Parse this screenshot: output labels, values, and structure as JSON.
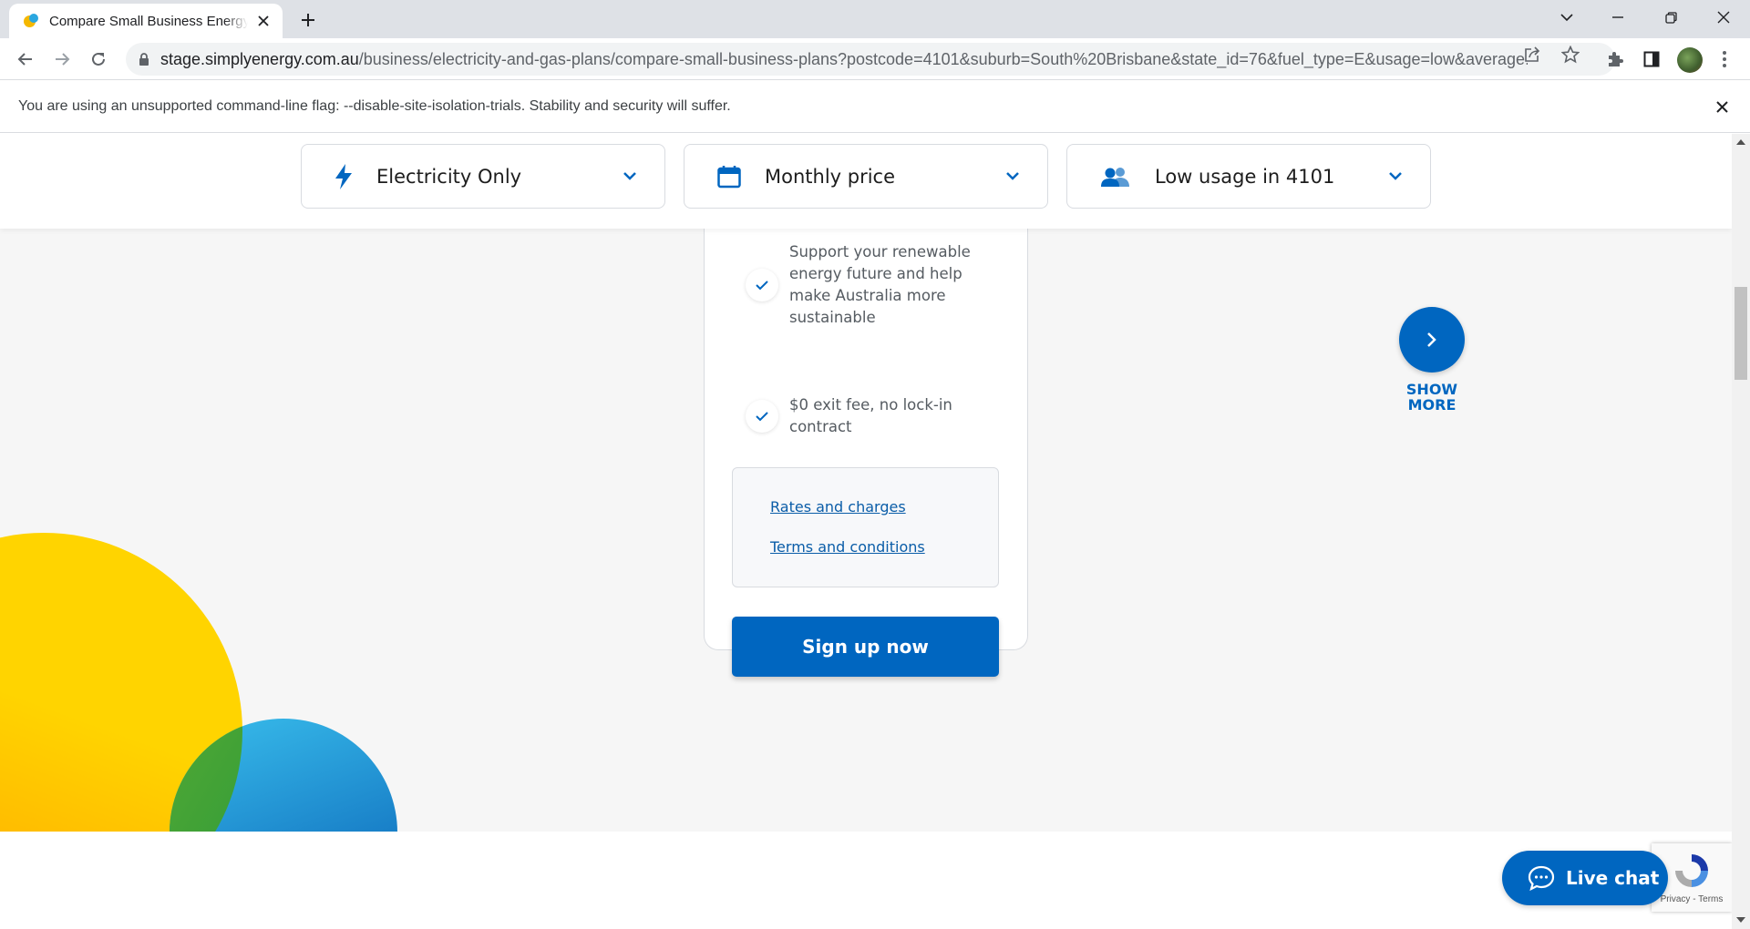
{
  "browser": {
    "tab_title": "Compare Small Business Energy Plans",
    "url_host": "stage.simplyenergy.com.au",
    "url_path": "/business/electricity-and-gas-plans/compare-small-business-plans?postcode=4101&suburb=South%20Brisbane&state_id=76&fuel_type=E&usage=low&average...",
    "infobar_message": "You are using an unsupported command-line flag: --disable-site-isolation-trials. Stability and security will suffer."
  },
  "filters": [
    {
      "label": "Electricity Only",
      "icon": "lightning-icon"
    },
    {
      "label": "Monthly price",
      "icon": "calendar-icon"
    },
    {
      "label": "Low usage in 4101",
      "icon": "users-icon"
    }
  ],
  "plan": {
    "features": [
      "Support your renewable energy future and help make Australia more sustainable",
      "$0 exit fee, no lock-in contract"
    ],
    "links": [
      "Rates and charges",
      "Terms and conditions"
    ],
    "cta": "Sign up now"
  },
  "show_more": {
    "line1": "SHOW",
    "line2": "MORE"
  },
  "live_chat": {
    "label": "Live chat"
  },
  "recaptcha": {
    "text": "Privacy - Terms"
  },
  "colors": {
    "brand_blue": "#0066c0",
    "link_blue": "#0a5da8",
    "page_bg": "#f6f6f6"
  }
}
